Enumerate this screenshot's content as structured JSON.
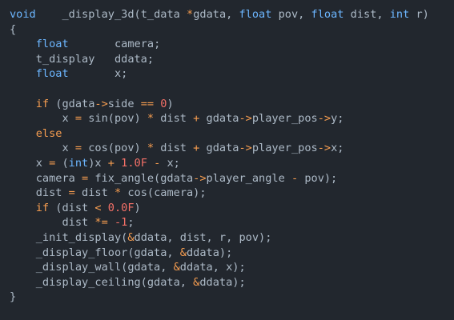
{
  "editor": {
    "language": "c",
    "colors": {
      "background": "#22272e",
      "keyword": "#6cb6ff",
      "number": "#f47067",
      "operator": "#f69d50",
      "identifier": "#adbac7"
    },
    "lines": [
      {
        "tokens": [
          {
            "t": "void",
            "c": "kw"
          },
          {
            "t": "    ",
            "c": "id"
          },
          {
            "t": "_display_3d",
            "c": "id"
          },
          {
            "t": "(",
            "c": "id"
          },
          {
            "t": "t_data",
            "c": "id"
          },
          {
            "t": " ",
            "c": "id"
          },
          {
            "t": "*",
            "c": "op"
          },
          {
            "t": "gdata, ",
            "c": "id"
          },
          {
            "t": "float",
            "c": "kw"
          },
          {
            "t": " pov, ",
            "c": "id"
          },
          {
            "t": "float",
            "c": "kw"
          },
          {
            "t": " dist, ",
            "c": "id"
          },
          {
            "t": "int",
            "c": "kw"
          },
          {
            "t": " r)",
            "c": "id"
          }
        ]
      },
      {
        "tokens": [
          {
            "t": "{",
            "c": "id"
          }
        ]
      },
      {
        "tokens": [
          {
            "t": "    ",
            "c": "id"
          },
          {
            "t": "float",
            "c": "kw"
          },
          {
            "t": "       camera;",
            "c": "id"
          }
        ]
      },
      {
        "tokens": [
          {
            "t": "    t_display   ddata;",
            "c": "id"
          }
        ]
      },
      {
        "tokens": [
          {
            "t": "    ",
            "c": "id"
          },
          {
            "t": "float",
            "c": "kw"
          },
          {
            "t": "       x;",
            "c": "id"
          }
        ]
      },
      {
        "tokens": []
      },
      {
        "tokens": [
          {
            "t": "    ",
            "c": "id"
          },
          {
            "t": "if",
            "c": "op"
          },
          {
            "t": " (gdata",
            "c": "id"
          },
          {
            "t": "->",
            "c": "op"
          },
          {
            "t": "side ",
            "c": "id"
          },
          {
            "t": "==",
            "c": "op"
          },
          {
            "t": " ",
            "c": "id"
          },
          {
            "t": "0",
            "c": "num"
          },
          {
            "t": ")",
            "c": "id"
          }
        ]
      },
      {
        "tokens": [
          {
            "t": "        x ",
            "c": "id"
          },
          {
            "t": "=",
            "c": "op"
          },
          {
            "t": " sin(pov) ",
            "c": "id"
          },
          {
            "t": "*",
            "c": "op"
          },
          {
            "t": " dist ",
            "c": "id"
          },
          {
            "t": "+",
            "c": "op"
          },
          {
            "t": " gdata",
            "c": "id"
          },
          {
            "t": "->",
            "c": "op"
          },
          {
            "t": "player_pos",
            "c": "id"
          },
          {
            "t": "->",
            "c": "op"
          },
          {
            "t": "y;",
            "c": "id"
          }
        ]
      },
      {
        "tokens": [
          {
            "t": "    ",
            "c": "id"
          },
          {
            "t": "else",
            "c": "op"
          }
        ]
      },
      {
        "tokens": [
          {
            "t": "        x ",
            "c": "id"
          },
          {
            "t": "=",
            "c": "op"
          },
          {
            "t": " cos(pov) ",
            "c": "id"
          },
          {
            "t": "*",
            "c": "op"
          },
          {
            "t": " dist ",
            "c": "id"
          },
          {
            "t": "+",
            "c": "op"
          },
          {
            "t": " gdata",
            "c": "id"
          },
          {
            "t": "->",
            "c": "op"
          },
          {
            "t": "player_pos",
            "c": "id"
          },
          {
            "t": "->",
            "c": "op"
          },
          {
            "t": "x;",
            "c": "id"
          }
        ]
      },
      {
        "tokens": [
          {
            "t": "    x ",
            "c": "id"
          },
          {
            "t": "=",
            "c": "op"
          },
          {
            "t": " (",
            "c": "id"
          },
          {
            "t": "int",
            "c": "kw"
          },
          {
            "t": ")x ",
            "c": "id"
          },
          {
            "t": "+",
            "c": "op"
          },
          {
            "t": " ",
            "c": "id"
          },
          {
            "t": "1.0F",
            "c": "num"
          },
          {
            "t": " ",
            "c": "id"
          },
          {
            "t": "-",
            "c": "op"
          },
          {
            "t": " x;",
            "c": "id"
          }
        ]
      },
      {
        "tokens": [
          {
            "t": "    camera ",
            "c": "id"
          },
          {
            "t": "=",
            "c": "op"
          },
          {
            "t": " fix_angle(gdata",
            "c": "id"
          },
          {
            "t": "->",
            "c": "op"
          },
          {
            "t": "player_angle ",
            "c": "id"
          },
          {
            "t": "-",
            "c": "op"
          },
          {
            "t": " pov);",
            "c": "id"
          }
        ]
      },
      {
        "tokens": [
          {
            "t": "    dist ",
            "c": "id"
          },
          {
            "t": "=",
            "c": "op"
          },
          {
            "t": " dist ",
            "c": "id"
          },
          {
            "t": "*",
            "c": "op"
          },
          {
            "t": " cos(camera);",
            "c": "id"
          }
        ]
      },
      {
        "tokens": [
          {
            "t": "    ",
            "c": "id"
          },
          {
            "t": "if",
            "c": "op"
          },
          {
            "t": " (dist ",
            "c": "id"
          },
          {
            "t": "<",
            "c": "op"
          },
          {
            "t": " ",
            "c": "id"
          },
          {
            "t": "0.0F",
            "c": "num"
          },
          {
            "t": ")",
            "c": "id"
          }
        ]
      },
      {
        "tokens": [
          {
            "t": "        dist ",
            "c": "id"
          },
          {
            "t": "*=",
            "c": "op"
          },
          {
            "t": " ",
            "c": "id"
          },
          {
            "t": "-1",
            "c": "num"
          },
          {
            "t": ";",
            "c": "id"
          }
        ]
      },
      {
        "tokens": [
          {
            "t": "    _init_display(",
            "c": "id"
          },
          {
            "t": "&",
            "c": "op"
          },
          {
            "t": "ddata, dist, r, pov);",
            "c": "id"
          }
        ]
      },
      {
        "tokens": [
          {
            "t": "    _display_floor(gdata, ",
            "c": "id"
          },
          {
            "t": "&",
            "c": "op"
          },
          {
            "t": "ddata);",
            "c": "id"
          }
        ]
      },
      {
        "tokens": [
          {
            "t": "    _display_wall(gdata, ",
            "c": "id"
          },
          {
            "t": "&",
            "c": "op"
          },
          {
            "t": "ddata, x);",
            "c": "id"
          }
        ]
      },
      {
        "tokens": [
          {
            "t": "    _display_ceiling(gdata, ",
            "c": "id"
          },
          {
            "t": "&",
            "c": "op"
          },
          {
            "t": "ddata);",
            "c": "id"
          }
        ]
      },
      {
        "tokens": [
          {
            "t": "}",
            "c": "id"
          }
        ]
      }
    ]
  }
}
